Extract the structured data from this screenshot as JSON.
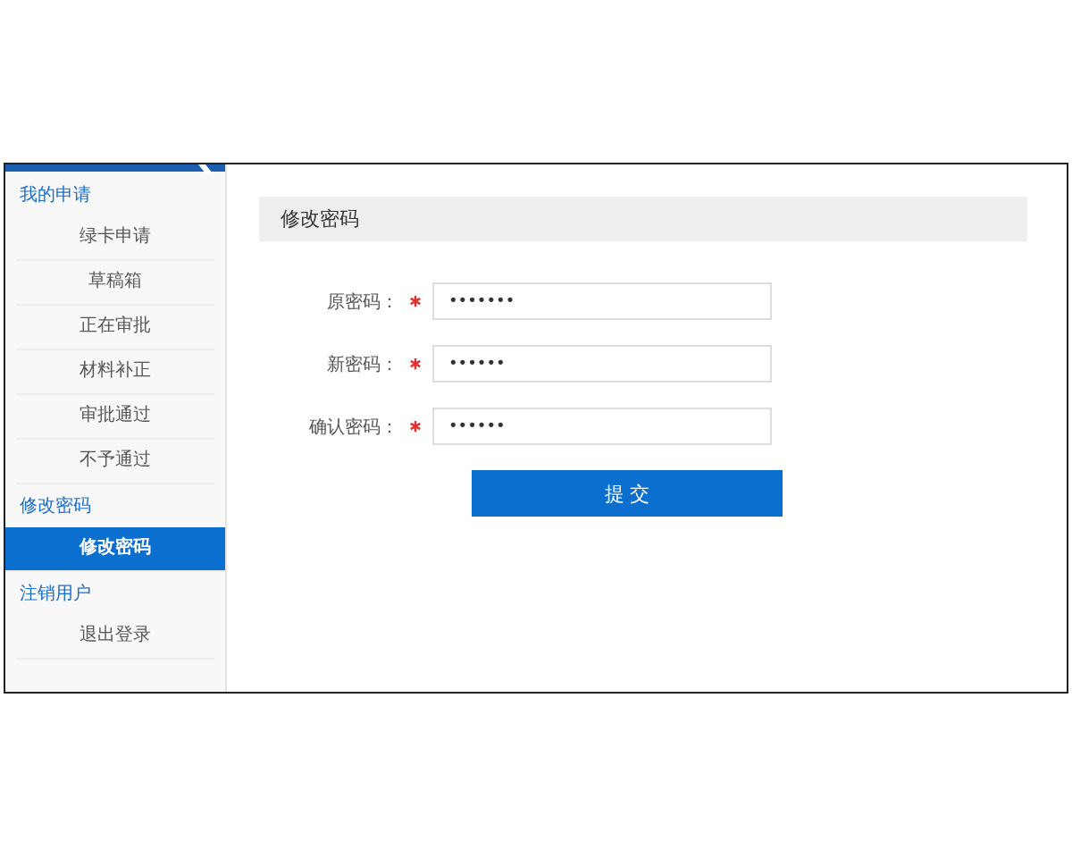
{
  "sidebar": {
    "groups": [
      {
        "title": "我的申请",
        "items": [
          {
            "label": "绿卡申请",
            "selected": false
          },
          {
            "label": "草稿箱",
            "selected": false
          },
          {
            "label": "正在审批",
            "selected": false
          },
          {
            "label": "材料补正",
            "selected": false
          },
          {
            "label": "审批通过",
            "selected": false
          },
          {
            "label": "不予通过",
            "selected": false
          }
        ]
      },
      {
        "title": "修改密码",
        "items": [
          {
            "label": "修改密码",
            "selected": true
          }
        ]
      },
      {
        "title": "注销用户",
        "items": [
          {
            "label": "退出登录",
            "selected": false
          }
        ]
      }
    ]
  },
  "panel": {
    "title": "修改密码",
    "fields": [
      {
        "label": "原密码：",
        "required": true,
        "value": "•••••••"
      },
      {
        "label": "新密码：",
        "required": true,
        "value": "••••••"
      },
      {
        "label": "确认密码：",
        "required": true,
        "value": "••••••"
      }
    ],
    "submit": "提 交"
  }
}
